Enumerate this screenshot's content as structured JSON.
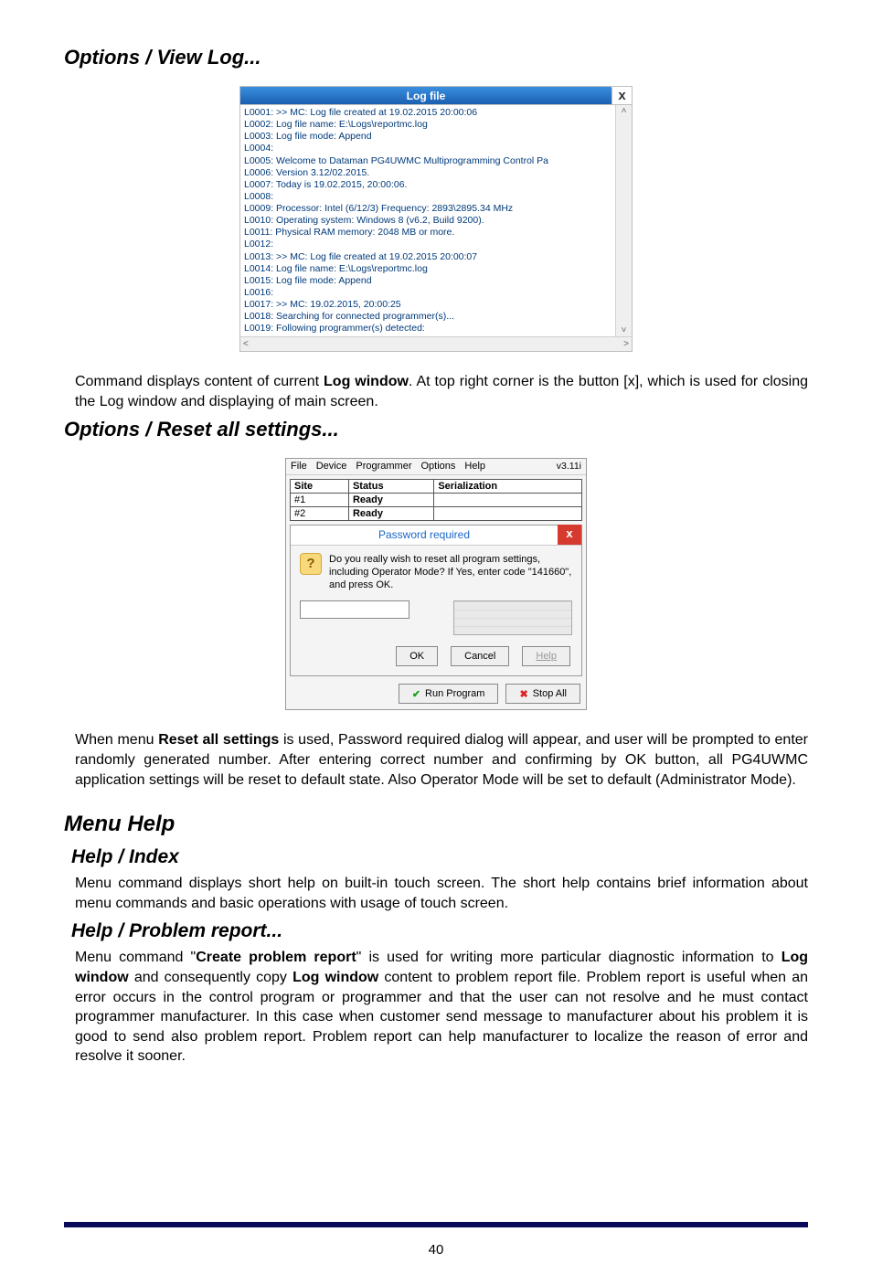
{
  "headings": {
    "view_log": "Options / View Log...",
    "reset_all": "Options / Reset all settings...",
    "menu_help": "Menu Help",
    "help_index": "Help / Index",
    "help_problem": "Help / Problem report..."
  },
  "paragraphs": {
    "log_desc_a": "Command displays content of current ",
    "log_desc_b": "Log window",
    "log_desc_c": ". At top right corner is the button [x], which is used for closing the Log window and displaying of main screen.",
    "reset_desc_a": "When menu ",
    "reset_desc_b": "Reset all settings",
    "reset_desc_c": " is used, Password required dialog will appear, and user will be prompted to enter randomly generated number. After entering correct number and confirming by OK button, all PG4UWMC application settings will be reset to default state. Also Operator Mode will be set to default (Administrator Mode).",
    "help_index_desc": "Menu command displays short help on built-in touch screen. The short help contains brief information about menu commands and basic operations with usage of touch screen.",
    "help_problem_a": "Menu command \"",
    "help_problem_b": "Create problem report",
    "help_problem_c": "\" is used for writing more particular diagnostic information to ",
    "help_problem_d": "Log window",
    "help_problem_e": " and consequently copy ",
    "help_problem_f": "Log window",
    "help_problem_g": " content to problem report file. Problem report is useful when an error occurs in the control program or programmer and that the user can not resolve and he must contact programmer manufacturer. In this case when customer send message to manufacturer about his problem it is good to send also problem report. Problem report can help manufacturer to localize the reason of error and resolve it sooner."
  },
  "logwin": {
    "title": "Log file",
    "close": "x",
    "lines": [
      "L0001:  >> MC: Log file created at 19.02.2015 20:00:06",
      "L0002:  Log file name: E:\\Logs\\reportmc.log",
      "L0003:  Log file mode: Append",
      "L0004:",
      "L0005:  Welcome to Dataman PG4UWMC Multiprogramming Control Pa",
      "L0006:  Version 3.12/02.2015.",
      "L0007:  Today is 19.02.2015, 20:00:06.",
      "L0008:",
      "L0009:  Processor: Intel (6/12/3)  Frequency: 2893\\2895.34 MHz",
      "L0010:  Operating system: Windows 8 (v6.2, Build 9200).",
      "L0011:  Physical RAM memory: 2048 MB or more.",
      "L0012:",
      "L0013:  >> MC: Log file created at 19.02.2015 20:00:07",
      "L0014:  Log file name: E:\\Logs\\reportmc.log",
      "L0015:  Log file mode: Append",
      "L0016:",
      "L0017:  >> MC: 19.02.2015, 20:00:25",
      "L0018:  Searching for connected programmer(s)...",
      "L0019:  Following programmer(s) detected:"
    ]
  },
  "pwwin": {
    "menubar": [
      "File",
      "Device",
      "Programmer",
      "Options",
      "Help"
    ],
    "version": "v3.11i",
    "table": {
      "headers": [
        "Site",
        "Status",
        "Serialization"
      ],
      "rows": [
        {
          "site": "#1",
          "status": "Ready"
        },
        {
          "site": "#2",
          "status": "Ready"
        }
      ]
    },
    "dialog": {
      "title": "Password required",
      "close": "x",
      "icon_glyph": "?",
      "message": "Do you really wish to reset all program settings, including Operator Mode? If Yes, enter code \"141660\", and press OK.",
      "input_value": "",
      "buttons": {
        "ok": "OK",
        "cancel": "Cancel",
        "help": "Help"
      }
    },
    "bottom": {
      "run": "Run Program",
      "stop": "Stop All"
    }
  },
  "page_number": "40"
}
